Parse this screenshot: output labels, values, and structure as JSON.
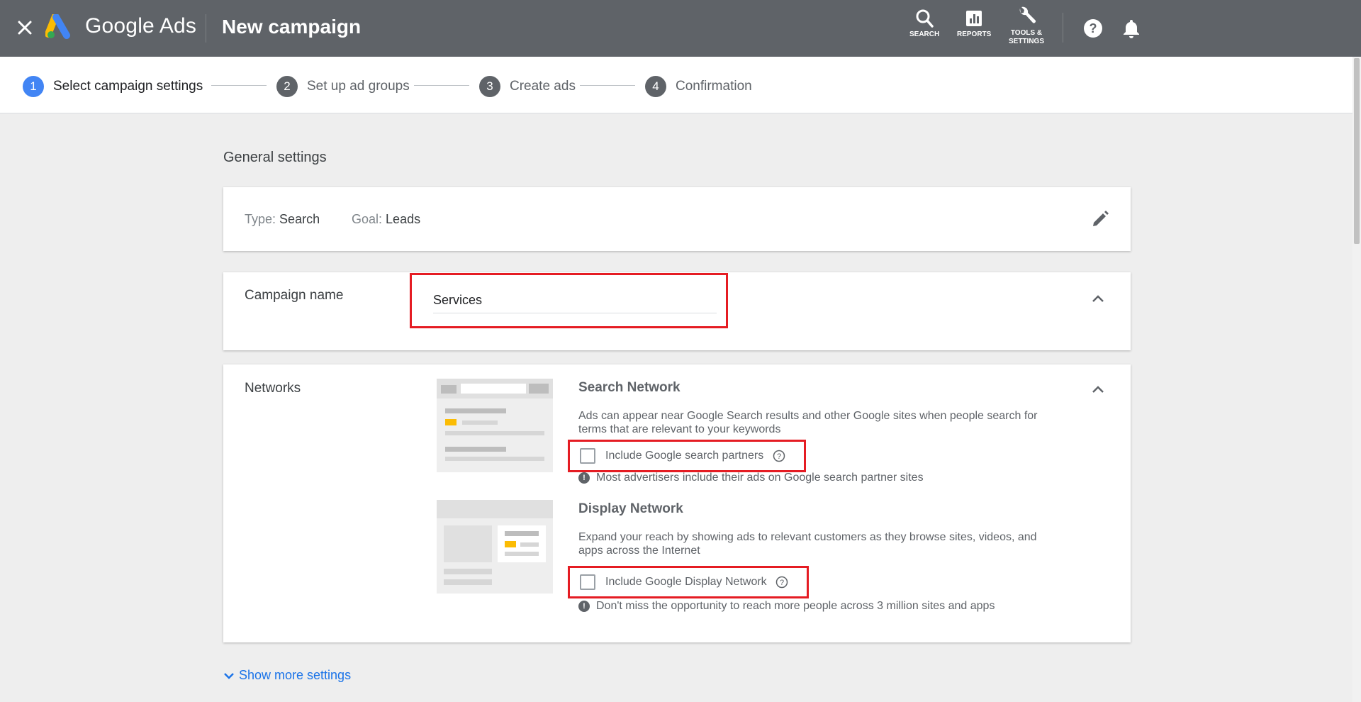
{
  "topbar": {
    "brand": "Google Ads",
    "title": "New campaign",
    "actions": [
      {
        "icon": "search-icon",
        "label": "SEARCH"
      },
      {
        "icon": "reports-icon",
        "label": "REPORTS"
      },
      {
        "icon": "wrench-icon",
        "label": "TOOLS &\nSETTINGS"
      }
    ]
  },
  "stepper": {
    "steps": [
      {
        "num": "1",
        "label": "Select campaign settings",
        "active": true
      },
      {
        "num": "2",
        "label": "Set up ad groups"
      },
      {
        "num": "3",
        "label": "Create ads"
      },
      {
        "num": "4",
        "label": "Confirmation"
      }
    ]
  },
  "general": {
    "title": "General settings",
    "type_key": "Type:",
    "type_value": "Search",
    "goal_key": "Goal:",
    "goal_value": "Leads"
  },
  "campaign_name": {
    "label": "Campaign name",
    "value": "Services"
  },
  "networks": {
    "label": "Networks",
    "search": {
      "heading": "Search Network",
      "description": "Ads can appear near Google Search results and other Google sites when people search for terms that are relevant to your keywords",
      "checkbox_label": "Include Google search partners",
      "checked": false,
      "note": "Most advertisers include their ads on Google search partner sites"
    },
    "display": {
      "heading": "Display Network",
      "description": "Expand your reach by showing ads to relevant customers as they browse sites, videos, and apps across the Internet",
      "checkbox_label": "Include Google Display Network",
      "checked": false,
      "note": "Don't miss the opportunity to reach more people across 3 million sites and apps"
    }
  },
  "show_more": "Show more settings",
  "colors": {
    "topbar": "#5f6368",
    "active_step": "#4285f4",
    "highlight": "#e51c23",
    "link": "#1a73e8"
  }
}
